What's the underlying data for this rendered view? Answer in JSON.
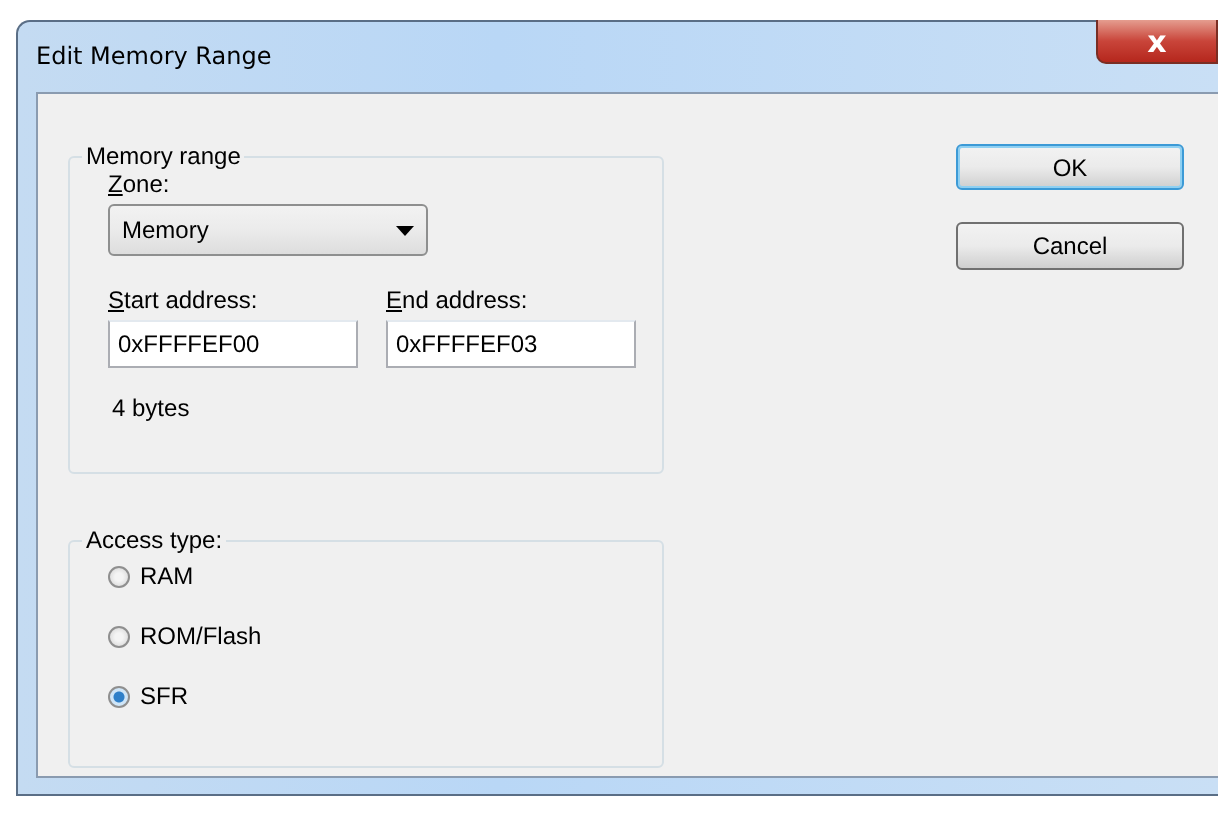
{
  "window": {
    "title": "Edit Memory Range",
    "close_label": "x"
  },
  "memory_range": {
    "title": "Memory range",
    "zone": {
      "label": "Zone:",
      "first_letter_underlined": true,
      "value": "Memory"
    },
    "start_address": {
      "label": "Start address:",
      "first_letter_underlined": true,
      "value": "0xFFFFEF00"
    },
    "end_address": {
      "label": "End address:",
      "first_letter_underlined": true,
      "value": "0xFFFFEF03"
    },
    "size": "4 bytes"
  },
  "access_type": {
    "title": "Access type:",
    "options": [
      {
        "label": "RAM",
        "selected": false
      },
      {
        "label": "ROM/Flash",
        "selected": false
      },
      {
        "label": "SFR",
        "selected": true
      }
    ]
  },
  "buttons": [
    {
      "label": "OK",
      "default": true
    },
    {
      "label": "Cancel",
      "default": false
    }
  ]
}
